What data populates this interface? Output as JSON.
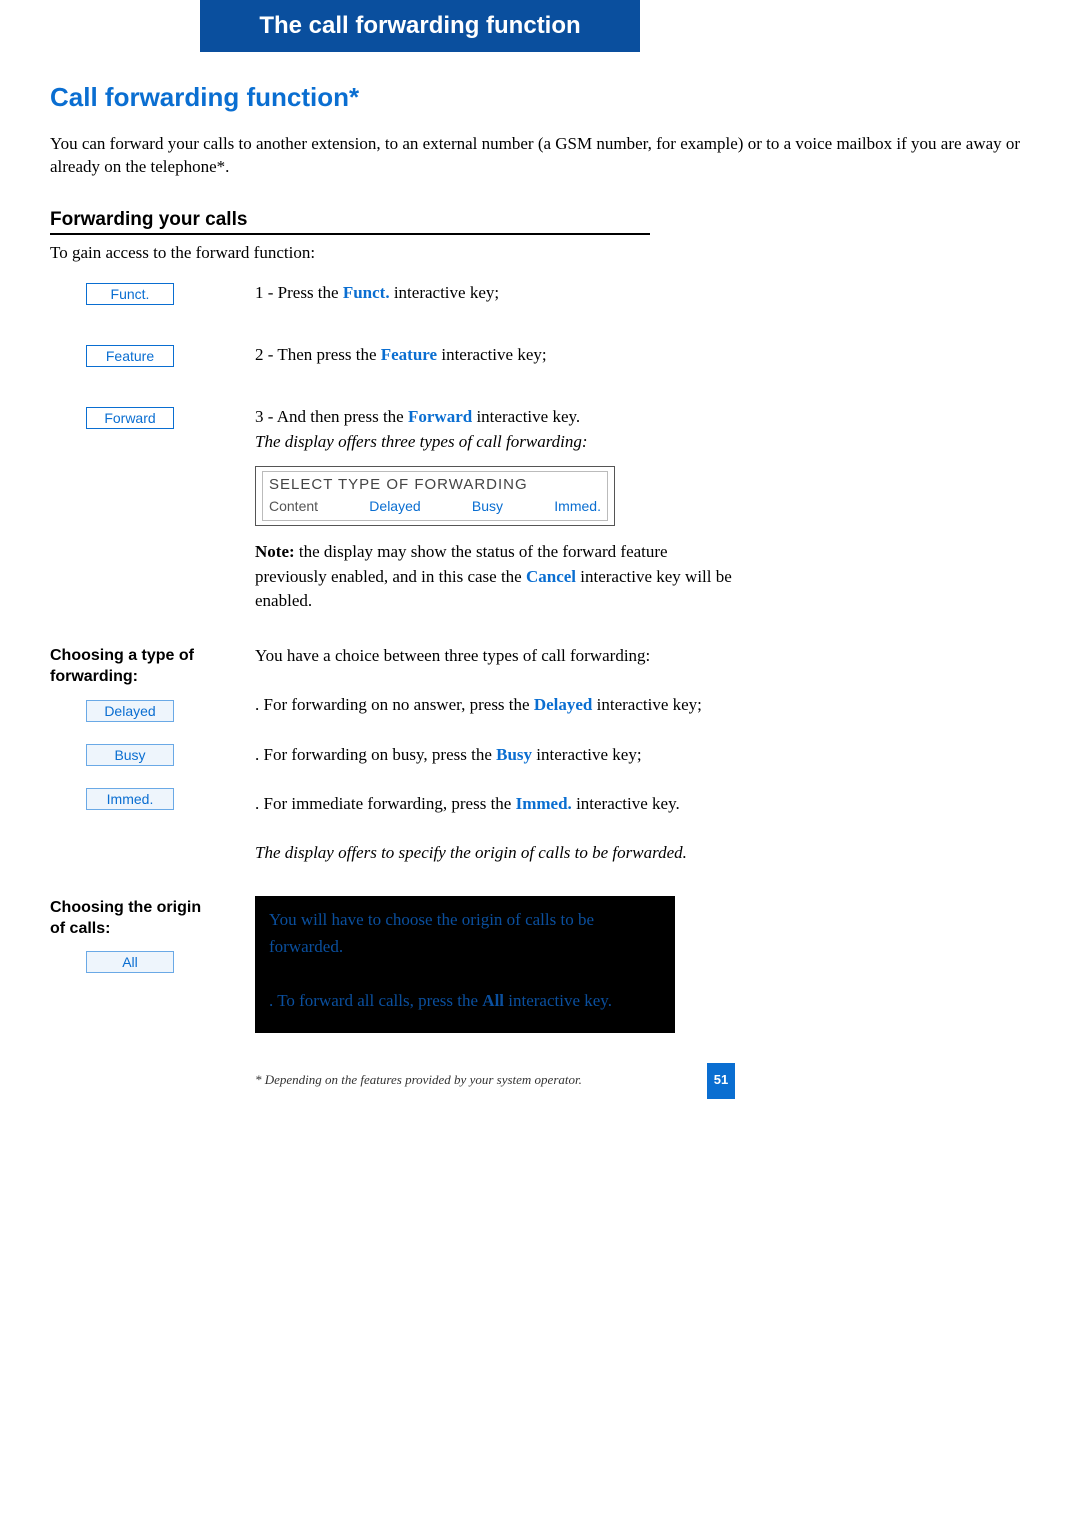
{
  "header": {
    "title": "The call forwarding function"
  },
  "main_title": "Call forwarding function*",
  "intro": "You can forward your calls to another extension, to an external number (a GSM number, for example) or to a voice mailbox if you are away or already on the telephone*.",
  "section1": {
    "heading": "Forwarding your calls",
    "access_line": "To gain access to the forward function:",
    "steps": [
      {
        "key": "Funct.",
        "pre": "1 - Press the ",
        "term": "Funct.",
        "post": " interactive key;"
      },
      {
        "key": "Feature",
        "pre": "2 - Then press the ",
        "term": "Feature",
        "post": " interactive key;"
      },
      {
        "key": "Forward",
        "pre": "3 - And then press the ",
        "term": "Forward",
        "post": " interactive key."
      }
    ],
    "after_step3": "The display offers three types of call forwarding:",
    "lcd": {
      "title": "SELECT TYPE OF FORWARDING",
      "col1": "Content",
      "opt1": "Delayed",
      "opt2": "Busy",
      "opt3": "Immed."
    },
    "note_label": "Note:",
    "note_body_a": " the display may show the status of the forward feature previously enabled, and in this case the ",
    "note_term": "Cancel",
    "note_body_b": " interactive key will be enabled."
  },
  "section2": {
    "heading": "Choosing a type of forwarding:",
    "intro": "You have a choice between three types of call forwarding:",
    "items": [
      {
        "key": "Delayed",
        "pre": ". For forwarding on no answer, press the ",
        "term": "Delayed",
        "post": " interactive key;"
      },
      {
        "key": "Busy",
        "pre": ". For forwarding on busy, press the ",
        "term": "Busy",
        "post": " interactive key;"
      },
      {
        "key": "Immed.",
        "pre": ". For immediate forwarding, press the ",
        "term": "Immed.",
        "post": " interactive key."
      }
    ],
    "after": "The display offers to specify the origin of calls to be forwarded."
  },
  "section3": {
    "heading": "Choosing the origin of calls:",
    "key": "All",
    "line1": "You will have to choose the origin of calls to be forwarded.",
    "line2_pre": ". To forward all calls, press the ",
    "line2_term": "All",
    "line2_post": " interactive key."
  },
  "footer": {
    "note": "* Depending on the features provided by your system operator.",
    "page": "51"
  }
}
